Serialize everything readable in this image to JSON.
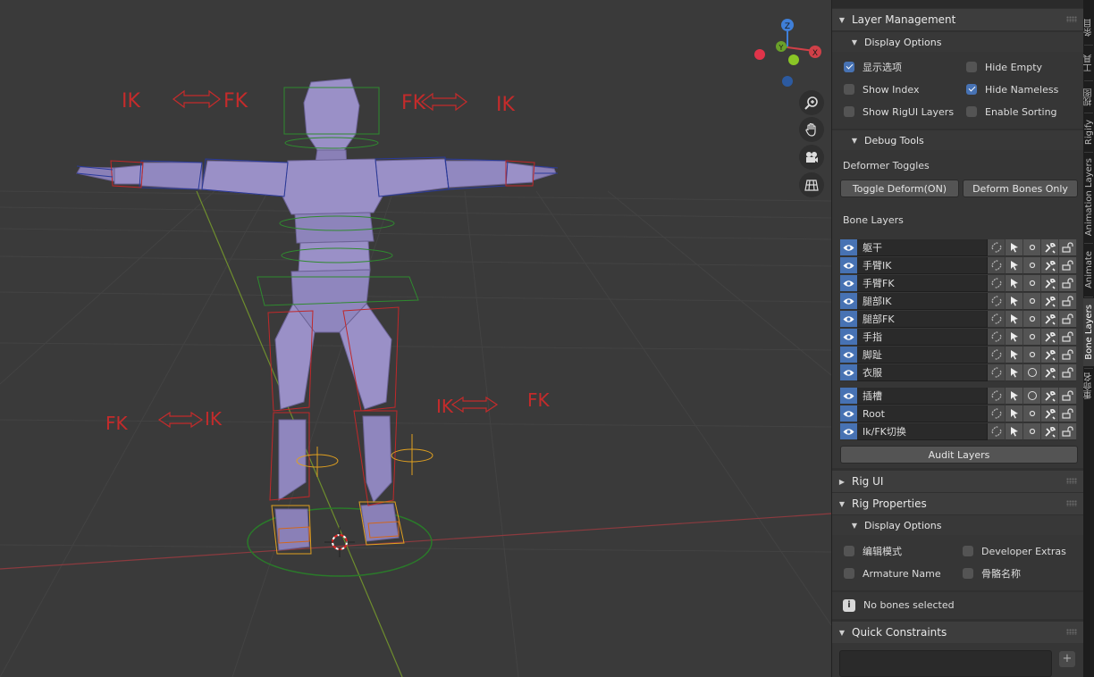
{
  "viewport": {
    "labels": {
      "ik_upper_left": "IK",
      "fk_upper_left": "FK",
      "fk_upper_right": "FK",
      "ik_upper_right": "IK",
      "fk_lower_left": "FK",
      "ik_lower_left": "IK",
      "ik_lower_right": "IK",
      "fk_lower_right": "FK"
    },
    "gizmo": {
      "z": "Z",
      "y": "Y",
      "x": "X"
    },
    "tools": [
      "zoom-icon",
      "hand-pan-icon",
      "camera-icon",
      "grid-ortho-icon"
    ]
  },
  "panel": {
    "layer_management": {
      "title": "Layer Management",
      "display_options": {
        "title": "Display Options",
        "options": [
          {
            "label": "显示选项",
            "checked": true
          },
          {
            "label": "Hide Empty",
            "checked": false
          },
          {
            "label": "Show Index",
            "checked": false
          },
          {
            "label": "Hide Nameless",
            "checked": true
          },
          {
            "label": "Show RigUI Layers",
            "checked": false
          },
          {
            "label": "Enable Sorting",
            "checked": false
          }
        ]
      },
      "debug_tools": {
        "title": "Debug Tools",
        "deformer_toggles": "Deformer Toggles",
        "toggle_deform": "Toggle Deform(ON)",
        "deform_bones_only": "Deform Bones Only"
      },
      "bone_layers": {
        "title": "Bone Layers",
        "group1": [
          "躯干",
          "手臂IK",
          "手臂FK",
          "腿部IK",
          "腿部FK",
          "手指",
          "脚趾",
          "衣服"
        ],
        "group2": [
          "插槽",
          "Root",
          "Ik/FK切换"
        ]
      },
      "audit_layers": "Audit Layers"
    },
    "rig_ui": {
      "title": "Rig UI"
    },
    "rig_properties": {
      "title": "Rig Properties",
      "display_options": {
        "title": "Display Options",
        "options": [
          {
            "label": "编辑模式",
            "checked": false
          },
          {
            "label": "Developer Extras",
            "checked": false
          },
          {
            "label": "Armature Name",
            "checked": false
          },
          {
            "label": "骨骼名称",
            "checked": false
          }
        ]
      },
      "status": "No bones selected"
    },
    "quick_constraints": {
      "title": "Quick Constraints",
      "add": "+"
    }
  },
  "tabs": [
    "条目",
    "工具",
    "视图",
    "Rigify",
    "Animation Layers",
    "Animate",
    "Bone Layers",
    "重命名"
  ],
  "active_tab": "Bone Layers",
  "colors": {
    "accent": "#4772b3",
    "panel": "#303030",
    "header": "#3d3d3d",
    "viewport": "#3a3a3a"
  }
}
